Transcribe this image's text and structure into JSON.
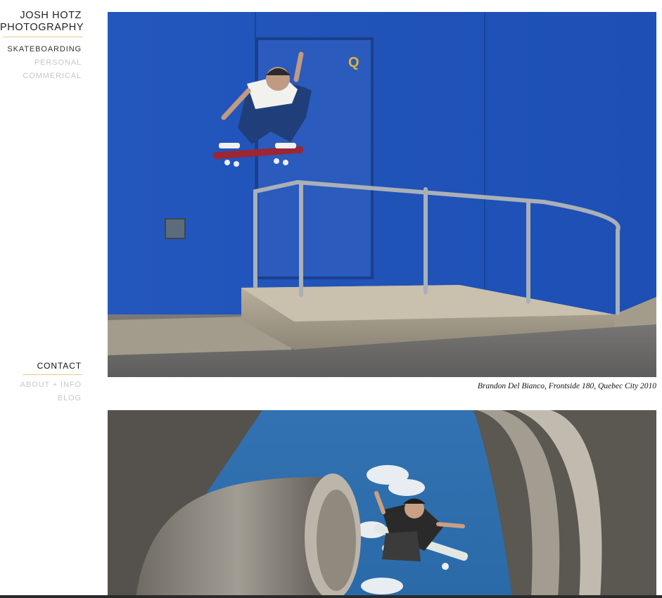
{
  "site": {
    "title_line1": "JOSH HOTZ",
    "title_line2": "PHOTOGRAPHY"
  },
  "nav": {
    "skateboarding": "SKATEBOARDING",
    "personal": "PERSONAL",
    "commercial": "COMMERICAL"
  },
  "contact": {
    "heading": "CONTACT",
    "about": "ABOUT + INFO",
    "blog": "BLOG"
  },
  "gallery": {
    "caption1": "Brandon Del Bianco, Frontside 180, Quebec City 2010"
  },
  "colors": {
    "accent_rule": "#e6c98a",
    "wall_blue": "#1f4fb0",
    "sky_blue": "#2c6aa8",
    "concrete": "#9a968d"
  }
}
